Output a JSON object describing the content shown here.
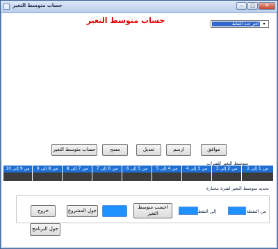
{
  "window": {
    "title": "حساب متوسط التغير",
    "controls": {
      "minimize": "–",
      "maximize": "□",
      "close": "✕"
    }
  },
  "heading": "حساب متوسط التغير",
  "points_select": {
    "value": "أختر عدد النقاط",
    "arrow": "▾"
  },
  "buttons": {
    "ok": "موافق",
    "draw": "ارسم",
    "edit": "تعديل",
    "clear": "مسح",
    "compute_avg": "حساب متوسط التغير",
    "compute_avg_period": "احسب متوسط التغير",
    "project_table": "جول المشروع",
    "exit": "خروج",
    "program_table": "جول البرنامج"
  },
  "periods_label": "متوسط التغير للفترات",
  "periods": [
    {
      "label": "من 1 إلى 2",
      "value": ""
    },
    {
      "label": "من 2 إلى 3",
      "value": ""
    },
    {
      "label": "من 3 إلى 4",
      "value": ""
    },
    {
      "label": "من 4 إلى 5",
      "value": ""
    },
    {
      "label": "من 5 إلى 6",
      "value": ""
    },
    {
      "label": "من 6 إلى 7",
      "value": ""
    },
    {
      "label": "من 7 إلى 8",
      "value": ""
    },
    {
      "label": "من 8 إلى 9",
      "value": ""
    },
    {
      "label": "من 9 إلى 10",
      "value": ""
    }
  ],
  "selected_period": {
    "title": "تحديد متوسط التغير لفترة مختارة",
    "from_label": "من النقطة",
    "to_label": "إلى النقطة",
    "from_value": "",
    "to_value": ""
  }
}
